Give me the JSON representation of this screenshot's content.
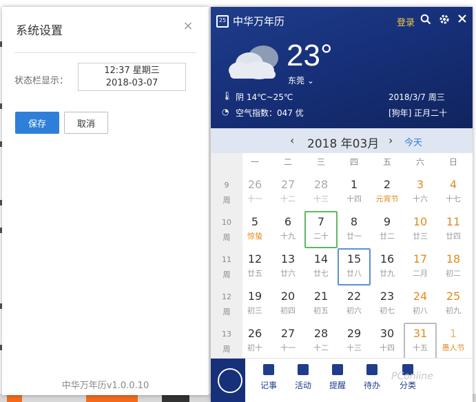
{
  "settings": {
    "title": "系统设置",
    "close_symbol": "×",
    "status_label": "状态栏显示：",
    "status_line1": "12:37 星期三",
    "status_line2": "2018-03-07",
    "save_label": "保存",
    "cancel_label": "取消",
    "version": "中华万年历v1.0.0.10"
  },
  "calendar": {
    "app_name": "中华万年历",
    "logo_text": "25",
    "login_label": "登录",
    "icons": [
      "search-icon",
      "gear-icon",
      "close-icon"
    ],
    "weather": {
      "temperature": "23°",
      "wind": "东莞",
      "condition": "阴",
      "range": "14℃~25℃",
      "aqi_label": "空气指数：047 优",
      "date": "2018/3/7 周三",
      "lunar": "[狗年] 正月二十"
    },
    "month_title": "2018 年03月",
    "today_label": "今天",
    "weekdays": [
      "一",
      "二",
      "三",
      "四",
      "五",
      "六",
      "日"
    ],
    "week_label": "周",
    "weeks": [
      {
        "num": "9",
        "days": [
          {
            "n": "26",
            "s": "十一",
            "st": "other"
          },
          {
            "n": "27",
            "s": "十二",
            "st": "other"
          },
          {
            "n": "28",
            "s": "十三",
            "st": "other"
          },
          {
            "n": "1",
            "s": "十四",
            "st": "norm"
          },
          {
            "n": "2",
            "s": "元宵节",
            "st": "fest"
          },
          {
            "n": "3",
            "s": "十六",
            "st": "wknd"
          },
          {
            "n": "4",
            "s": "十七",
            "st": "wknd"
          }
        ]
      },
      {
        "num": "10",
        "days": [
          {
            "n": "5",
            "s": "惊蛰",
            "st": "term"
          },
          {
            "n": "6",
            "s": "十九",
            "st": "norm"
          },
          {
            "n": "7",
            "s": "二十",
            "st": "today"
          },
          {
            "n": "8",
            "s": "廿一",
            "st": "norm"
          },
          {
            "n": "9",
            "s": "廿二",
            "st": "norm"
          },
          {
            "n": "10",
            "s": "廿三",
            "st": "wknd"
          },
          {
            "n": "11",
            "s": "廿四",
            "st": "wknd"
          }
        ]
      },
      {
        "num": "11",
        "days": [
          {
            "n": "12",
            "s": "廿五",
            "st": "norm"
          },
          {
            "n": "13",
            "s": "廿六",
            "st": "norm"
          },
          {
            "n": "14",
            "s": "廿七",
            "st": "norm"
          },
          {
            "n": "15",
            "s": "廿八",
            "st": "sel"
          },
          {
            "n": "16",
            "s": "廿九",
            "st": "norm"
          },
          {
            "n": "17",
            "s": "二月",
            "st": "wknd"
          },
          {
            "n": "18",
            "s": "初二",
            "st": "wknd"
          }
        ]
      },
      {
        "num": "12",
        "days": [
          {
            "n": "19",
            "s": "初三",
            "st": "norm"
          },
          {
            "n": "20",
            "s": "初四",
            "st": "norm"
          },
          {
            "n": "21",
            "s": "初五",
            "st": "norm"
          },
          {
            "n": "22",
            "s": "初六",
            "st": "norm"
          },
          {
            "n": "23",
            "s": "初七",
            "st": "norm"
          },
          {
            "n": "24",
            "s": "初八",
            "st": "wknd"
          },
          {
            "n": "25",
            "s": "初九",
            "st": "wknd"
          }
        ]
      },
      {
        "num": "13",
        "days": [
          {
            "n": "26",
            "s": "初十",
            "st": "norm"
          },
          {
            "n": "27",
            "s": "十一",
            "st": "norm"
          },
          {
            "n": "28",
            "s": "十二",
            "st": "norm"
          },
          {
            "n": "29",
            "s": "十三",
            "st": "norm"
          },
          {
            "n": "30",
            "s": "十四",
            "st": "norm"
          },
          {
            "n": "31",
            "s": "十五",
            "st": "wkndbox"
          },
          {
            "n": "1",
            "s": "愚人节",
            "st": "otherfest"
          }
        ]
      }
    ],
    "toolbar": [
      {
        "label": "记事",
        "icon": "note-icon"
      },
      {
        "label": "活动",
        "icon": "calendar-icon"
      },
      {
        "label": "提醒",
        "icon": "bell-icon"
      },
      {
        "label": "待办",
        "icon": "clipboard-icon"
      },
      {
        "label": "分类",
        "icon": "category-icon"
      }
    ],
    "watermark": "PConline"
  },
  "colors": {
    "header_blue": "#1f3d8a",
    "save_blue": "#2e7fd9",
    "weekend_orange": "#e08a1e",
    "today_green": "#5cb85c",
    "selected_blue": "#5a8fd6"
  }
}
